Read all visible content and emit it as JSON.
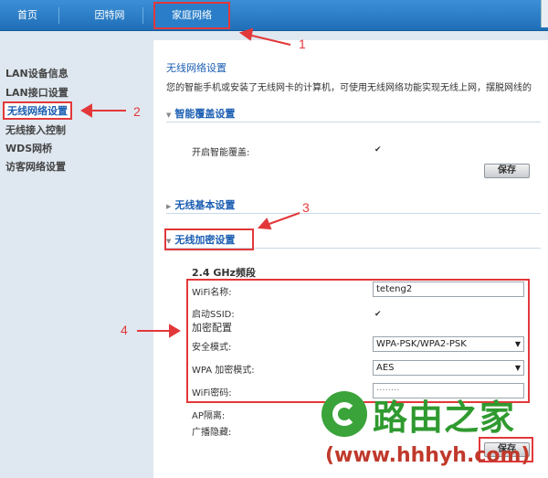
{
  "nav": {
    "home": "首页",
    "wan": "因特网",
    "home_network": "家庭网络"
  },
  "sidebar": {
    "items": [
      {
        "label": "LAN设备信息"
      },
      {
        "label": "LAN接口设置"
      },
      {
        "label": "无线网络设置",
        "active": true
      },
      {
        "label": "无线接入控制"
      },
      {
        "label": "WDS网桥"
      },
      {
        "label": "访客网络设置"
      }
    ]
  },
  "main": {
    "title": "无线网络设置",
    "description": "您的智能手机或安装了无线网卡的计算机，可使用无线网络功能实现无线上网，摆脱网线的",
    "smart_cover": {
      "heading": "智能覆盖设置",
      "enable_label": "开启智能覆盖:",
      "enable_checked": true,
      "save_label": "保存"
    },
    "basic": {
      "heading": "无线基本设置"
    },
    "security": {
      "heading": "无线加密设置",
      "band": "2.4 GHz频段",
      "wifi_name_label": "WiFi名称:",
      "wifi_name_value": "teteng2",
      "ssid_label": "启动SSID:",
      "ssid_checked": true,
      "encrypt_config": "加密配置",
      "security_mode_label": "安全模式:",
      "security_mode_value": "WPA-PSK/WPA2-PSK",
      "wpa_mode_label": "WPA 加密模式:",
      "wpa_mode_value": "AES",
      "wifi_pwd_label": "WiFi密码:",
      "wifi_pwd_value": "········",
      "ap_isolation_label": "AP隔离:",
      "broadcast_hide_label": "广播隐藏:",
      "save_label": "保存"
    }
  },
  "annotations": {
    "n1": "1",
    "n2": "2",
    "n3": "3",
    "n4": "4",
    "color": "#e2383a"
  },
  "watermark": {
    "brand": "路由之家",
    "url": "(www.hhhyh.com)",
    "icon": "router-home-logo-icon"
  }
}
